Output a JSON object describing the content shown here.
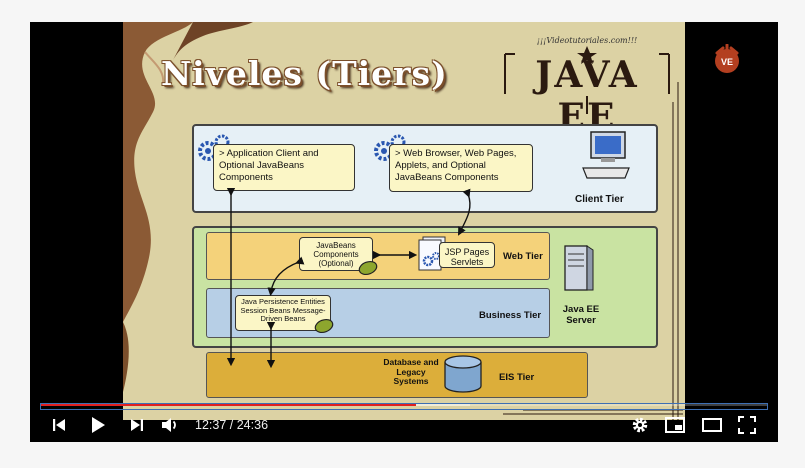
{
  "slide": {
    "title": "Niveles (Tiers)",
    "logo": {
      "sub": "¡¡¡Videotutoriales.com!!!",
      "main": "JAVA EE"
    },
    "client_tier": {
      "label": "Client Tier",
      "app_client": "> Application Client and Optional JavaBeans Components",
      "web_browser": "> Web Browser, Web Pages, Applets, and Optional JavaBeans Components"
    },
    "server": {
      "label": "Java EE Server"
    },
    "web_tier": {
      "label": "Web Tier",
      "javabeans": "JavaBeans Components (Optional)",
      "jsp": "JSP Pages Servlets"
    },
    "business_tier": {
      "label": "Business Tier",
      "entities": "Java Persistence Entities Session Beans Message-Driven Beans"
    },
    "eis_tier": {
      "label": "EIS Tier",
      "database": "Database and Legacy Systems"
    }
  },
  "player": {
    "time_current": "12:37",
    "time_separator": "/",
    "time_total": "24:36",
    "progress_played_fraction": 0.517,
    "progress_loaded_fraction": 0.59,
    "accent_color": "#e02020",
    "icons": [
      "previous-icon",
      "play-icon",
      "next-icon",
      "volume-icon",
      "settings-icon",
      "miniplayer-icon",
      "theater-icon",
      "fullscreen-icon"
    ]
  }
}
